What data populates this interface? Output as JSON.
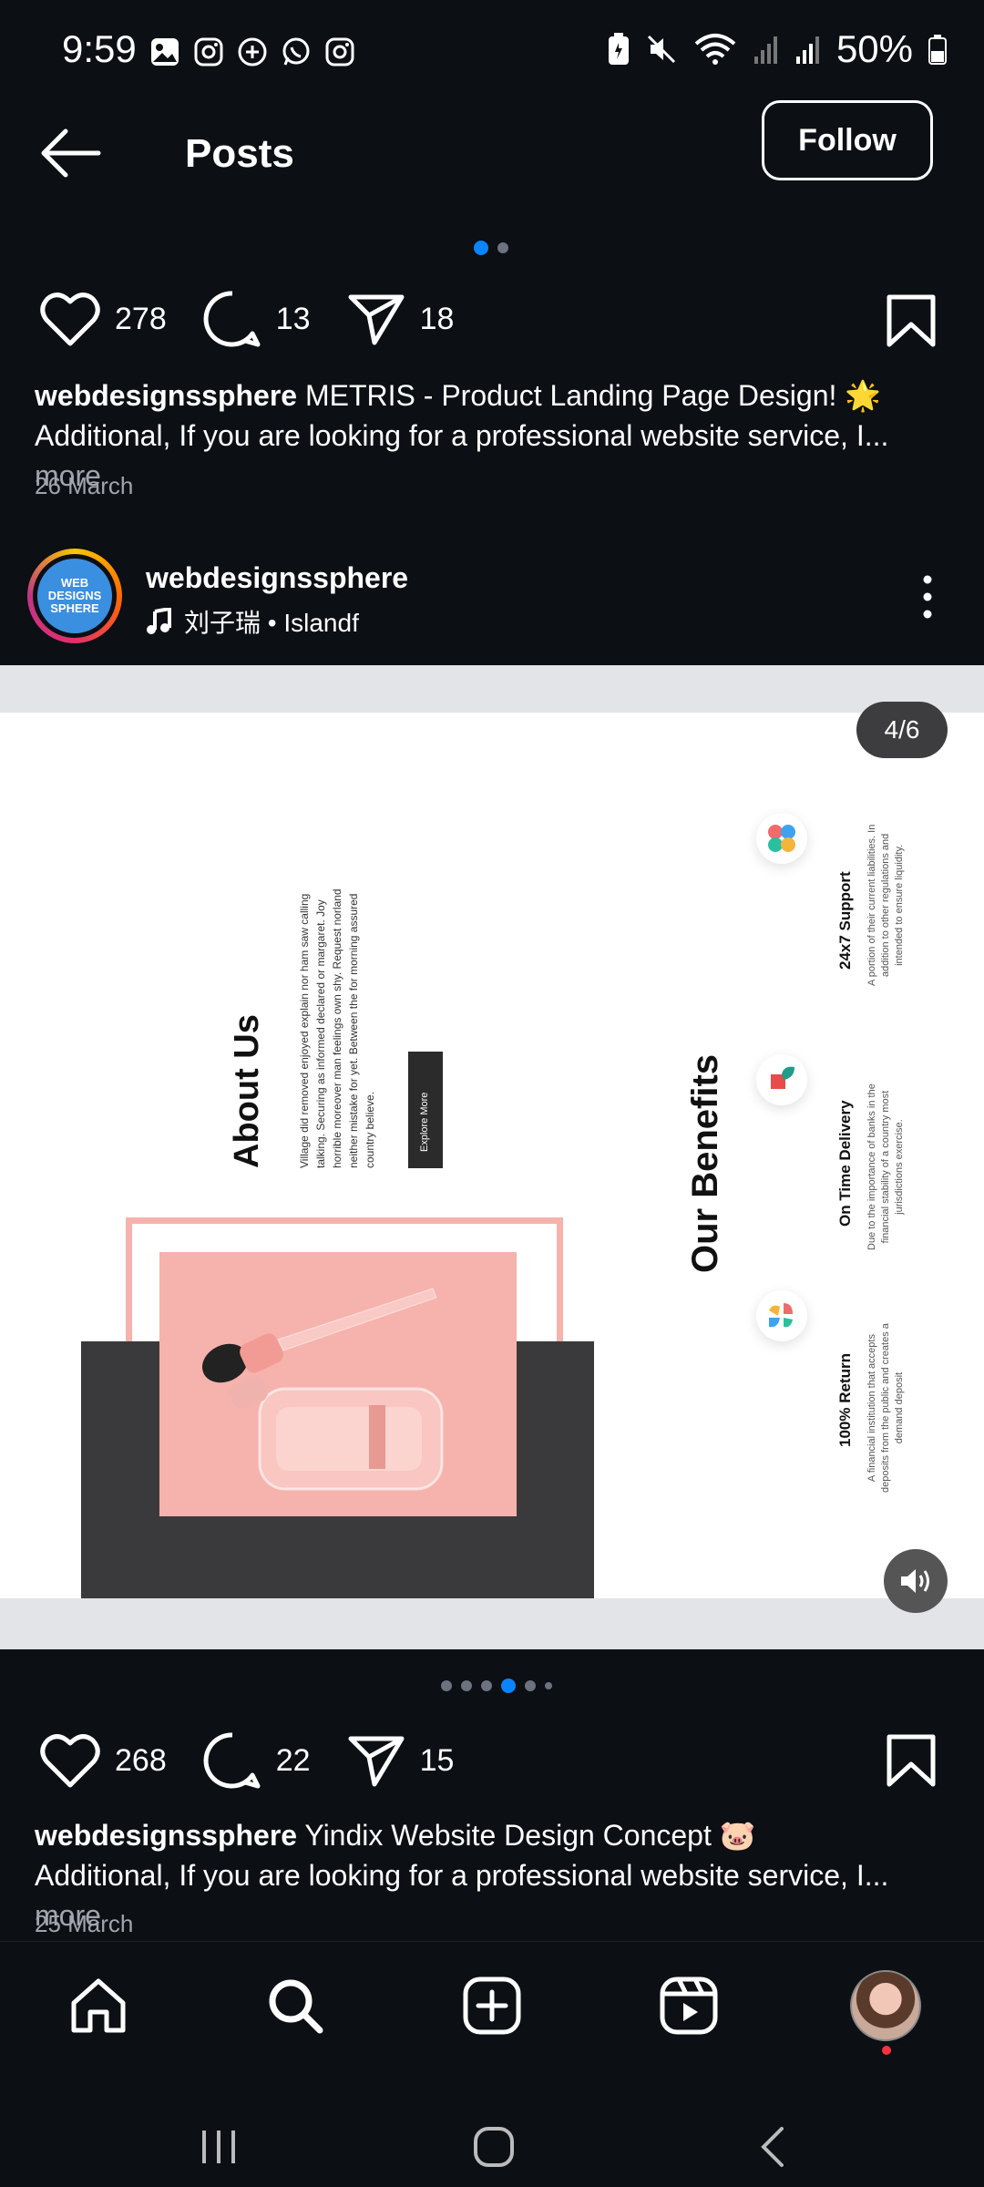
{
  "status_bar": {
    "time": "9:59",
    "battery": "50%",
    "notification_icons": [
      "gallery-icon",
      "instagram-icon",
      "threads-icon",
      "whatsapp-icon",
      "instagram-icon"
    ],
    "system_icons": [
      "battery-saver-icon",
      "mute-icon",
      "wifi-icon",
      "signal-icon",
      "signal-icon",
      "battery-icon"
    ]
  },
  "header": {
    "title": "Posts",
    "follow_label": "Follow"
  },
  "post1": {
    "likes": "278",
    "comments": "13",
    "shares": "18",
    "username": "webdesignssphere",
    "caption_title": " METRIS - Product Landing Page Design! 🌟",
    "caption_body": "Additional, If you are looking for a professional website service, I...",
    "more": " more",
    "date": "26 March"
  },
  "post2": {
    "avatar_text": "WEB DESIGNS SPHERE",
    "username": "webdesignssphere",
    "audio": "刘子瑞 • Islandf",
    "counter": "4/6",
    "slide": {
      "about_title": "About Us",
      "about_text": [
        "Village did removed enjoyed explain nor ham saw calling",
        "talking. Securing as informed declared or margaret. Joy",
        "horrible moreover man feelings own shy. Request norland",
        "neither mistake for yet. Between the for morning assured",
        "country believe."
      ],
      "explore_label": "Explore More",
      "benefits_title": "Our Benefits",
      "benefits": [
        {
          "title": "24x7 Support",
          "text": [
            "A portion of their current liabilities. In",
            "addition to other regulations and",
            "intended to ensure liquidity."
          ]
        },
        {
          "title": "On Time Delivery",
          "text": [
            "Due to the importance of banks in the",
            "financial stability of a country most",
            "jurisdictions exercise."
          ]
        },
        {
          "title": "100% Return",
          "text": [
            "A financial institution that accepts",
            "deposits from the public and creates a",
            "demand deposit"
          ]
        }
      ]
    },
    "likes": "268",
    "comments": "22",
    "shares": "15",
    "caption_title": " Yindix Website Design Concept 🐷",
    "caption_body": "Additional, If you are looking for a professional website service, I...",
    "more": " more",
    "date": "25 March"
  },
  "bottom_nav": [
    "home-icon",
    "search-icon",
    "create-icon",
    "reels-icon",
    "profile-avatar"
  ],
  "colors": {
    "background": "#0c0f14",
    "accent": "#0a84ff",
    "pink": "#f6b2ac",
    "dark_panel": "#3a3a3c"
  }
}
